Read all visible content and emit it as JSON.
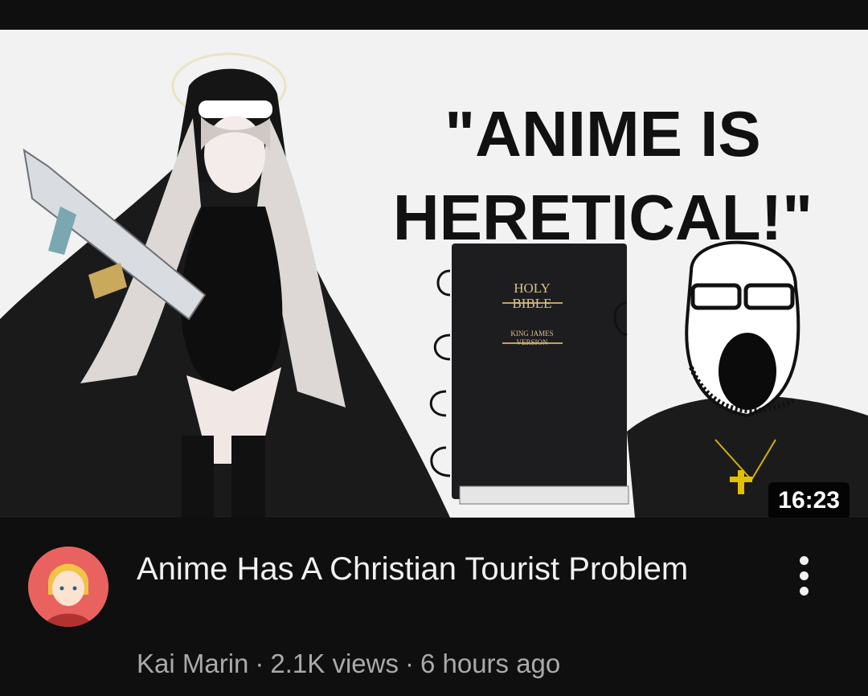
{
  "video": {
    "thumbnail": {
      "headline_line1": "\"ANIME IS",
      "headline_line2": "HERETICAL!\"",
      "book_title_line1": "HOLY",
      "book_title_line2": "BIBLE",
      "book_subtitle_line1": "KING JAMES",
      "book_subtitle_line2": "VERSION"
    },
    "duration": "16:23",
    "title": "Anime Has A Christian Tourist Problem",
    "channel": "Kai Marin",
    "views": "2.1K views",
    "age": "6 hours ago",
    "separator": "·"
  },
  "icons": {
    "menu": "more-vert-icon",
    "avatar": "channel-avatar"
  },
  "colors": {
    "background": "#0f0f0f",
    "thumbnail_bg": "#f2f2f2",
    "avatar_bg": "#e9625f",
    "meta_text": "#aaaaaa"
  }
}
